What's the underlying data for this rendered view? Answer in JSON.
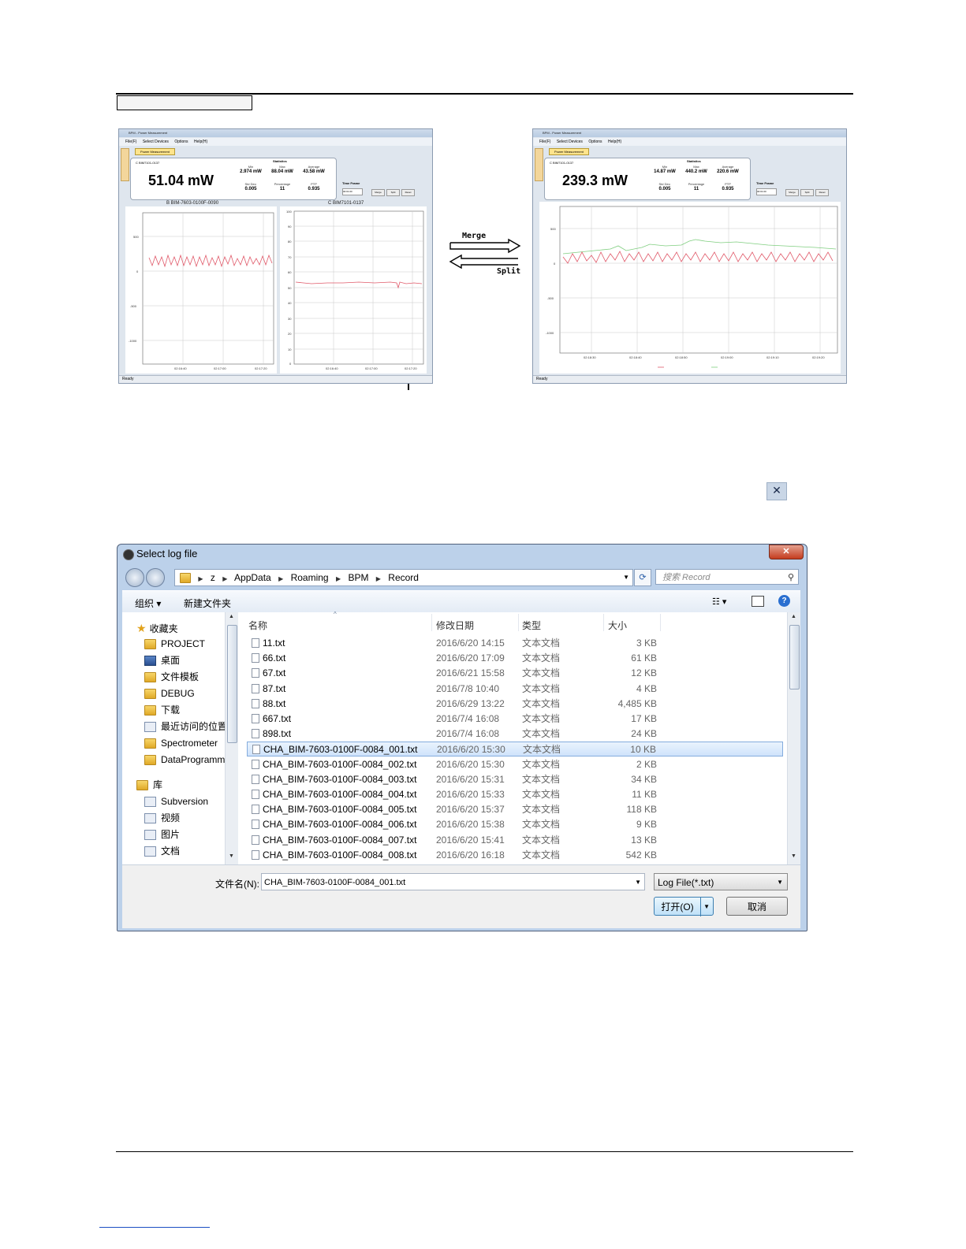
{
  "doc": {
    "caption_box": ""
  },
  "arrows": {
    "merge": "Merge",
    "split": "Split"
  },
  "close_x": "✕",
  "left_app": {
    "title": "BPM - Power Measurement",
    "menu": [
      "File(F)",
      "Select Devices",
      "Options",
      "Help(H)"
    ],
    "tab": "Power Measurement",
    "device": "C   BIM7101-0137",
    "power": "51.04 mW",
    "stats_title": "Statistics",
    "stats": [
      {
        "label": "Min",
        "value": "2.974 mW"
      },
      {
        "label": "Max",
        "value": "88.04 mW"
      },
      {
        "label": "Average",
        "value": "43.58 mW"
      },
      {
        "label": "Std Dev.",
        "value": "0.005"
      },
      {
        "label": "Percentage",
        "value": "11"
      },
      {
        "label": "PTP",
        "value": "0.935"
      }
    ],
    "time_frame_label": "Time Frame",
    "time_frame_value": "00:01:00",
    "buttons": [
      "Merge",
      "Split",
      "Reset"
    ],
    "status": "Ready",
    "chart_b_title": "B    BIM-7603-0100F-0090",
    "chart_c_title": "C    BIM7101-0137"
  },
  "right_app": {
    "title": "BPM - Power Measurement",
    "menu": [
      "File(F)",
      "Select Devices",
      "Options",
      "Help(H)"
    ],
    "tab": "Power Measurement",
    "device": "C   BIM7101-0137",
    "power": "239.3 mW",
    "stats_title": "Statistics",
    "stats": [
      {
        "label": "Min",
        "value": "14.87 mW"
      },
      {
        "label": "Max",
        "value": "440.2 mW"
      },
      {
        "label": "Average",
        "value": "220.6 mW"
      },
      {
        "label": "Std Dev.",
        "value": "0.005"
      },
      {
        "label": "Percentage",
        "value": "11"
      },
      {
        "label": "PTP",
        "value": "0.935"
      }
    ],
    "time_frame_label": "Time Frame",
    "time_frame_value": "00:01:00",
    "buttons": [
      "Merge",
      "Split",
      "Reset"
    ],
    "status": "Ready"
  },
  "dialog": {
    "title": "Select log file",
    "close": "✕",
    "breadcrumb": [
      "z",
      "AppData",
      "Roaming",
      "BPM",
      "Record"
    ],
    "search_placeholder": "搜索 Record",
    "toolbar": {
      "organize": "组织 ▾",
      "new_folder": "新建文件夹"
    },
    "nav": {
      "favorites_header": "收藏夹",
      "favorites": [
        "PROJECT",
        "桌面",
        "文件模板",
        "DEBUG",
        "下载",
        "最近访问的位置",
        "Spectrometer",
        "DataProgramm"
      ],
      "libraries_header": "库",
      "libraries": [
        "Subversion",
        "视频",
        "图片",
        "文档"
      ]
    },
    "columns": {
      "name": "名称",
      "date": "修改日期",
      "type": "类型",
      "size": "大小"
    },
    "files": [
      {
        "name": "11.txt",
        "date": "2016/6/20 14:15",
        "type": "文本文档",
        "size": "3 KB"
      },
      {
        "name": "66.txt",
        "date": "2016/6/20 17:09",
        "type": "文本文档",
        "size": "61 KB"
      },
      {
        "name": "67.txt",
        "date": "2016/6/21 15:58",
        "type": "文本文档",
        "size": "12 KB"
      },
      {
        "name": "87.txt",
        "date": "2016/7/8 10:40",
        "type": "文本文档",
        "size": "4 KB"
      },
      {
        "name": "88.txt",
        "date": "2016/6/29 13:22",
        "type": "文本文档",
        "size": "4,485 KB"
      },
      {
        "name": "667.txt",
        "date": "2016/7/4 16:08",
        "type": "文本文档",
        "size": "17 KB"
      },
      {
        "name": "898.txt",
        "date": "2016/7/4 16:08",
        "type": "文本文档",
        "size": "24 KB"
      },
      {
        "name": "CHA_BIM-7603-0100F-0084_001.txt",
        "date": "2016/6/20 15:30",
        "type": "文本文档",
        "size": "10 KB",
        "selected": true
      },
      {
        "name": "CHA_BIM-7603-0100F-0084_002.txt",
        "date": "2016/6/20 15:30",
        "type": "文本文档",
        "size": "2 KB"
      },
      {
        "name": "CHA_BIM-7603-0100F-0084_003.txt",
        "date": "2016/6/20 15:31",
        "type": "文本文档",
        "size": "34 KB"
      },
      {
        "name": "CHA_BIM-7603-0100F-0084_004.txt",
        "date": "2016/6/20 15:33",
        "type": "文本文档",
        "size": "11 KB"
      },
      {
        "name": "CHA_BIM-7603-0100F-0084_005.txt",
        "date": "2016/6/20 15:37",
        "type": "文本文档",
        "size": "118 KB"
      },
      {
        "name": "CHA_BIM-7603-0100F-0084_006.txt",
        "date": "2016/6/20 15:38",
        "type": "文本文档",
        "size": "9 KB"
      },
      {
        "name": "CHA_BIM-7603-0100F-0084_007.txt",
        "date": "2016/6/20 15:41",
        "type": "文本文档",
        "size": "13 KB"
      },
      {
        "name": "CHA_BIM-7603-0100F-0084_008.txt",
        "date": "2016/6/20 16:18",
        "type": "文本文档",
        "size": "542 KB"
      }
    ],
    "filename_label": "文件名(N):",
    "filename_value": "CHA_BIM-7603-0100F-0084_001.txt",
    "filetype": "Log File(*.txt)",
    "open": "打开(O)",
    "cancel": "取消"
  }
}
